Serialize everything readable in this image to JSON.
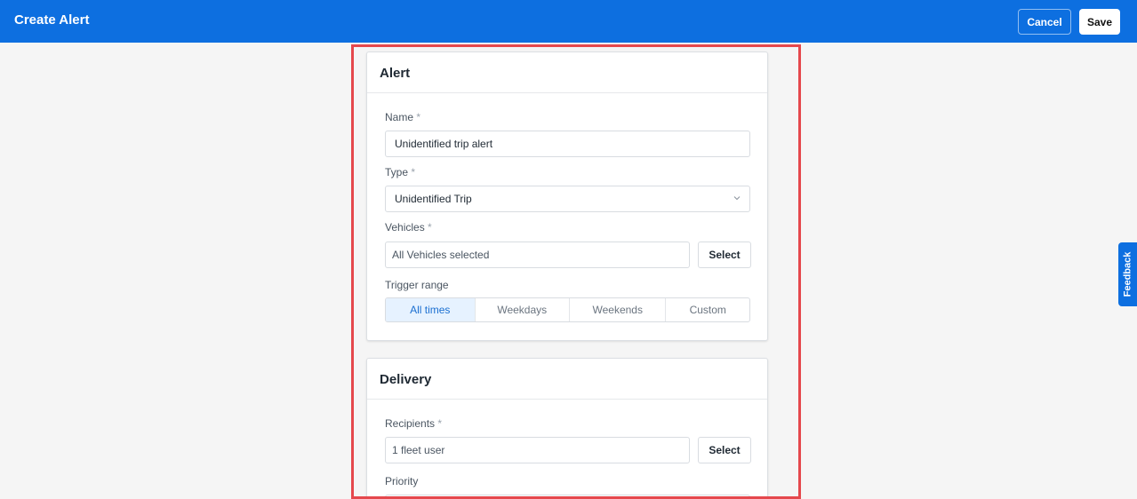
{
  "header": {
    "title": "Create Alert",
    "cancel_label": "Cancel",
    "save_label": "Save"
  },
  "alert_card": {
    "title": "Alert",
    "name": {
      "label": "Name",
      "required_mark": "*",
      "value": "Unidentified trip alert"
    },
    "type": {
      "label": "Type",
      "required_mark": "*",
      "value": "Unidentified Trip",
      "icon": "chevron-down-icon"
    },
    "vehicles": {
      "label": "Vehicles",
      "required_mark": "*",
      "value": "All Vehicles selected",
      "select_label": "Select"
    },
    "trigger_range": {
      "label": "Trigger range",
      "options": [
        "All times",
        "Weekdays",
        "Weekends",
        "Custom"
      ],
      "selected": "All times"
    }
  },
  "delivery_card": {
    "title": "Delivery",
    "recipients": {
      "label": "Recipients",
      "required_mark": "*",
      "value": "1 fleet user",
      "select_label": "Select"
    },
    "priority": {
      "label": "Priority"
    }
  },
  "feedback_tab": {
    "label": "Feedback"
  },
  "colors": {
    "brand_blue": "#0d6fe0",
    "highlight_red": "#e5484d",
    "segment_active_bg": "#e6f2ff",
    "segment_active_text": "#1a6fd1"
  }
}
